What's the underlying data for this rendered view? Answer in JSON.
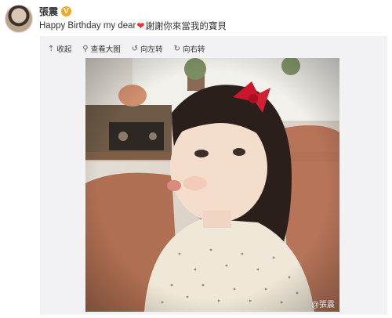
{
  "post": {
    "author": "張震",
    "verified_badge": "V",
    "text_before": "Happy Birthday my dear",
    "heart_emoji": "❤",
    "text_after": "謝謝你來當我的寶貝"
  },
  "toolbar": {
    "collapse_label": "收起",
    "view_large_label": "查看大图",
    "rotate_left_label": "向左转",
    "rotate_right_label": "向右转",
    "collapse_icon": "collapse-icon",
    "zoom_icon": "magnifier-icon",
    "rotate_left_icon": "rotate-left-icon",
    "rotate_right_icon": "rotate-right-icon"
  },
  "photo": {
    "watermark": "@張震"
  },
  "colors": {
    "verified": "#f5a623",
    "heart": "#e4352d",
    "panel_bg": "#f2f2f5",
    "text": "#333333"
  }
}
